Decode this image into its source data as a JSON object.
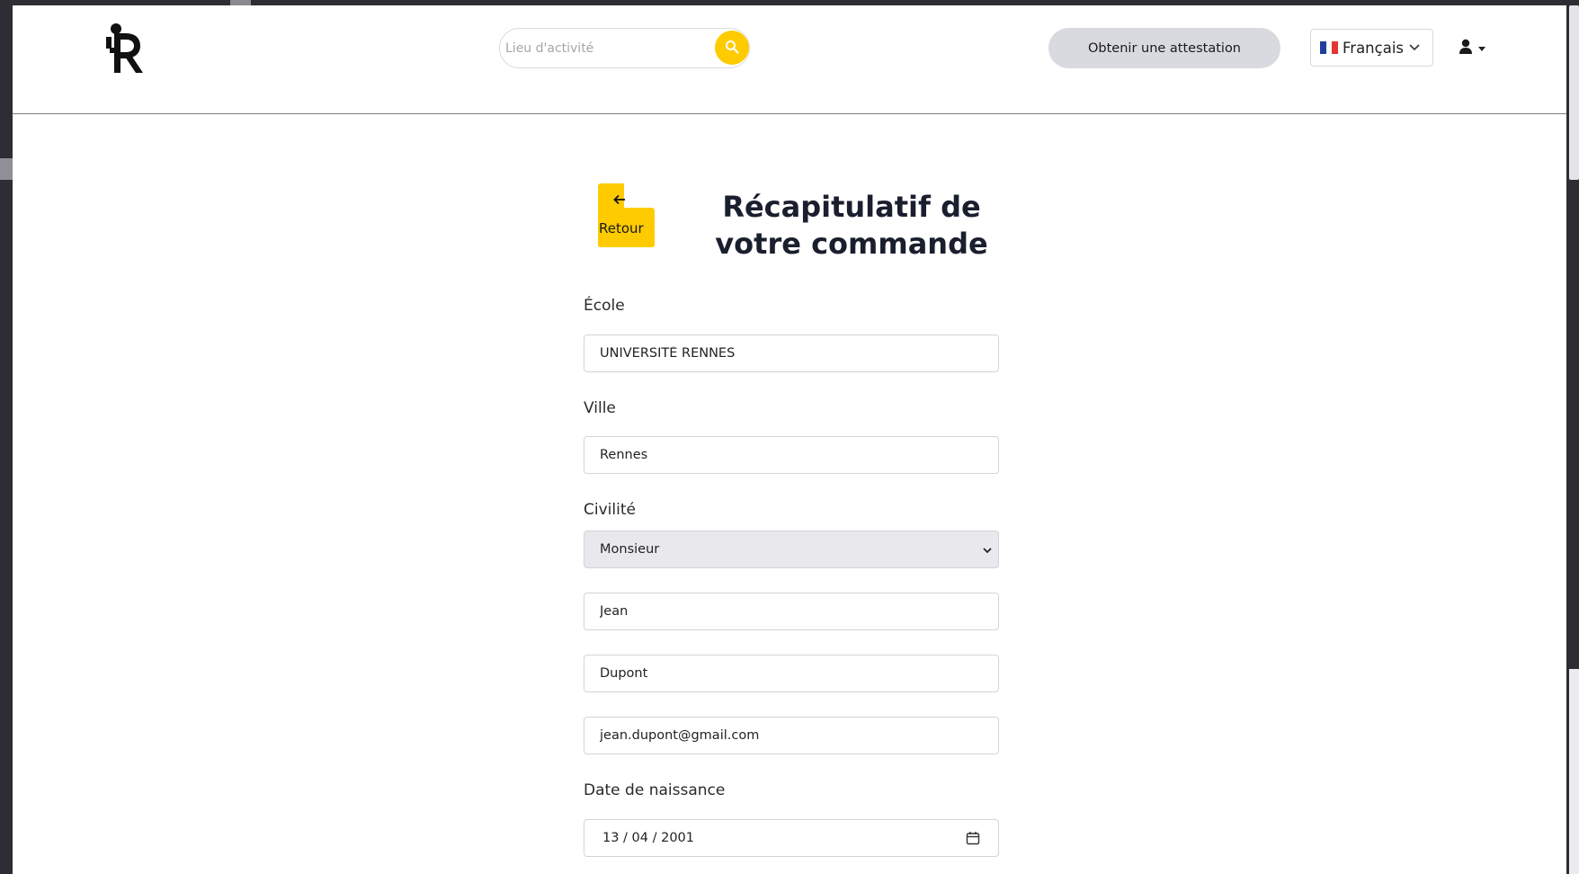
{
  "header": {
    "search": {
      "placeholder": "Lieu d'activité"
    },
    "attestation_button": "Obtenir une attestation",
    "language": {
      "selected": "Français",
      "flag": "fr"
    }
  },
  "main": {
    "back_button": {
      "arrow": "🡐",
      "label": "Retour"
    },
    "title": "Récapitulatif de votre commande",
    "form": {
      "ecole": {
        "label": "École",
        "value": "UNIVERSITÉ RENNES"
      },
      "ville": {
        "label": "Ville",
        "value": "Rennes"
      },
      "civilite": {
        "label": "Civilité",
        "selected": "Monsieur"
      },
      "prenom": {
        "value": "Jean"
      },
      "nom": {
        "value": "Dupont"
      },
      "email": {
        "value": "jean.dupont@gmail.com"
      },
      "naissance": {
        "label": "Date de naissance",
        "value": "13 / 04 / 2001"
      }
    }
  },
  "colors": {
    "accent": "#fdcb00",
    "title": "#1a1f2e",
    "button_gray": "#d9dadf"
  }
}
